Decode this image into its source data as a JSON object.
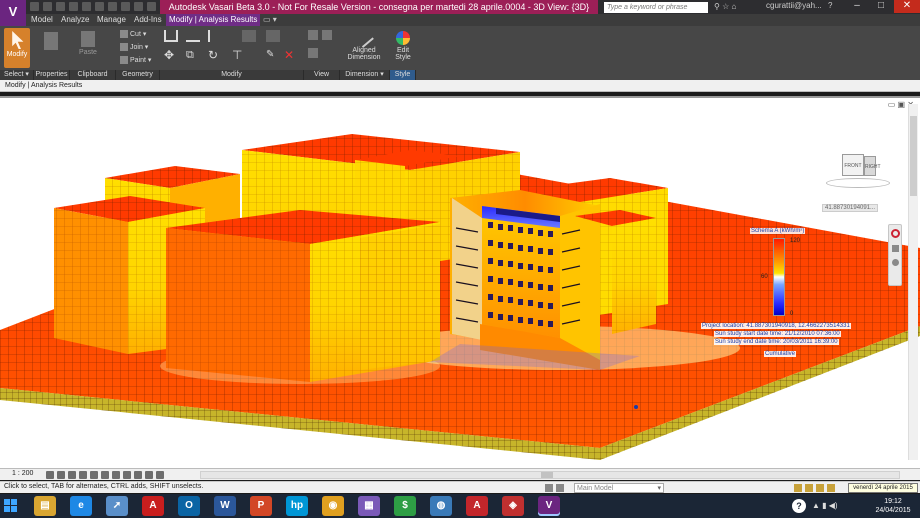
{
  "app": {
    "logo": "V",
    "title": "Autodesk Vasari Beta 3.0 - Not For Resale Version -      consegna per martedi 28 aprile.0004 - 3D View: {3D}",
    "search_placeholder": "Type a keyword or phrase",
    "user": "cgurattii@yah...",
    "help": "?",
    "window_min": "–",
    "window_max": "□",
    "window_close": "✕"
  },
  "tabs": [
    {
      "label": "Model"
    },
    {
      "label": "Analyze"
    },
    {
      "label": "Manage"
    },
    {
      "label": "Add-Ins"
    },
    {
      "label": "Modify | Analysis Results",
      "active": true
    }
  ],
  "ribbon": {
    "modify_label": "Modify",
    "paste_label": "Paste",
    "cut_label": "Cut",
    "join_label": "Join",
    "paint_label": "Paint",
    "aligned_label_1": "Aligned",
    "aligned_label_2": "Dimension",
    "edit_style_label_1": "Edit",
    "edit_style_label_2": "Style",
    "groups": {
      "select": "Select ▾",
      "properties": "Properties",
      "clipboard": "Clipboard",
      "geometry": "Geometry",
      "modify": "Modify",
      "view": "View",
      "dimension": "Dimension ▾",
      "style": "Style"
    }
  },
  "options_bar": "Modify | Analysis Results",
  "view": {
    "cube_front": "FRONT",
    "cube_right": "RIGHT",
    "coord_tag": "41.88730194091...",
    "controls": "▭ ▣ ✕",
    "scale": "1 : 200"
  },
  "legend": {
    "title": "Schema A (kWh/m²)",
    "max": "120",
    "mid": "60",
    "min": "0",
    "colors": {
      "high": "#ff1a00",
      "mid": "#ffe400",
      "low": "#0000c8"
    }
  },
  "info": {
    "location": "Project location: 41.887301940918, 12.4662273514331",
    "start": "Sun study start date time: 21/12/2010 07:36:00",
    "end": "Sun study end date time: 20/03/2011 16:39:00",
    "mode": "Cumulative"
  },
  "status": {
    "text": "Click to select, TAB for alternates, CTRL adds, SHIFT unselects.",
    "workset": "Main Model",
    "date_tooltip": "venerdì 24 aprile 2015"
  },
  "taskbar": {
    "apps": [
      {
        "name": "file-explorer",
        "glyph": "▤",
        "color": "#d9a632"
      },
      {
        "name": "internet-explorer",
        "glyph": "e",
        "color": "#1e88e5"
      },
      {
        "name": "rocket-app",
        "glyph": "➚",
        "color": "#5a8fc9"
      },
      {
        "name": "acrobat",
        "glyph": "A",
        "color": "#c81e1e"
      },
      {
        "name": "outlook",
        "glyph": "O",
        "color": "#0a64a4"
      },
      {
        "name": "word",
        "glyph": "W",
        "color": "#2b579a"
      },
      {
        "name": "powerpoint",
        "glyph": "P",
        "color": "#d24726"
      },
      {
        "name": "hp-app",
        "glyph": "hp",
        "color": "#0096d6"
      },
      {
        "name": "chrome",
        "glyph": "◉",
        "color": "#e0a020"
      },
      {
        "name": "grid-app",
        "glyph": "▦",
        "color": "#7a5ab8"
      },
      {
        "name": "dollar-app",
        "glyph": "$",
        "color": "#2e9e45"
      },
      {
        "name": "globe-app",
        "glyph": "◍",
        "color": "#3a7ab8"
      },
      {
        "name": "autodesk-a",
        "glyph": "A",
        "color": "#c3262b"
      },
      {
        "name": "vasari-alt",
        "glyph": "◈",
        "color": "#c03030"
      },
      {
        "name": "vasari",
        "glyph": "V",
        "color": "#6b2580"
      }
    ],
    "tray_icons": "▲ ▮ ◀)",
    "time": "19:12",
    "date": "24/04/2015"
  }
}
